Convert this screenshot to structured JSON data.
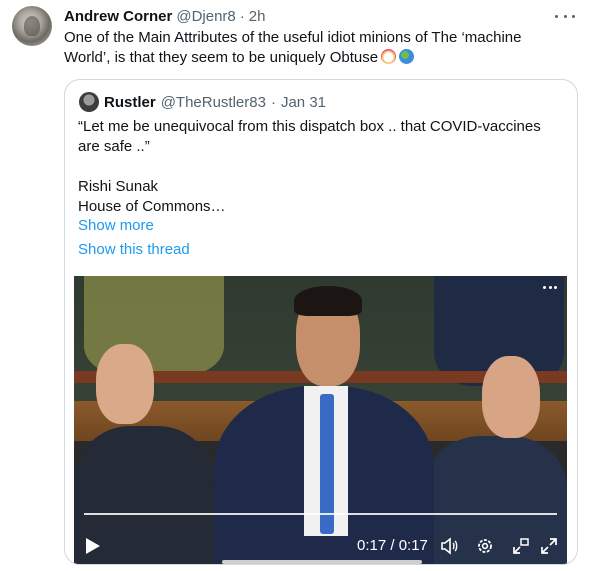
{
  "tweet": {
    "author_name": "Andrew Corner",
    "author_handle": "@Djenr8",
    "separator": "·",
    "time": "2h",
    "text": "One of the Main Attributes of the useful idiot minions of The ‘machine World’, is that they seem to be uniquely Obtuse",
    "emojis": [
      "clown-face",
      "globe"
    ]
  },
  "quoted": {
    "author_name": "Rustler",
    "author_handle": "@TheRustler83",
    "separator": "·",
    "time": "Jan 31",
    "line1": "“Let me be unequivocal from this dispatch box .. that COVID-vaccines are safe ..”",
    "line2": "Rishi Sunak",
    "line3": "House of Commons…",
    "show_more": "Show more",
    "show_thread": "Show this thread"
  },
  "video": {
    "time_display": "0:17 / 0:17",
    "progress": 1.0
  },
  "icons": [
    "more-icon",
    "play-icon",
    "volume-icon",
    "settings-icon",
    "pip-icon",
    "fullscreen-icon"
  ],
  "colors": {
    "link": "#1d9bf0",
    "muted": "#536471",
    "text": "#0f1419",
    "border": "#cfd9de"
  }
}
